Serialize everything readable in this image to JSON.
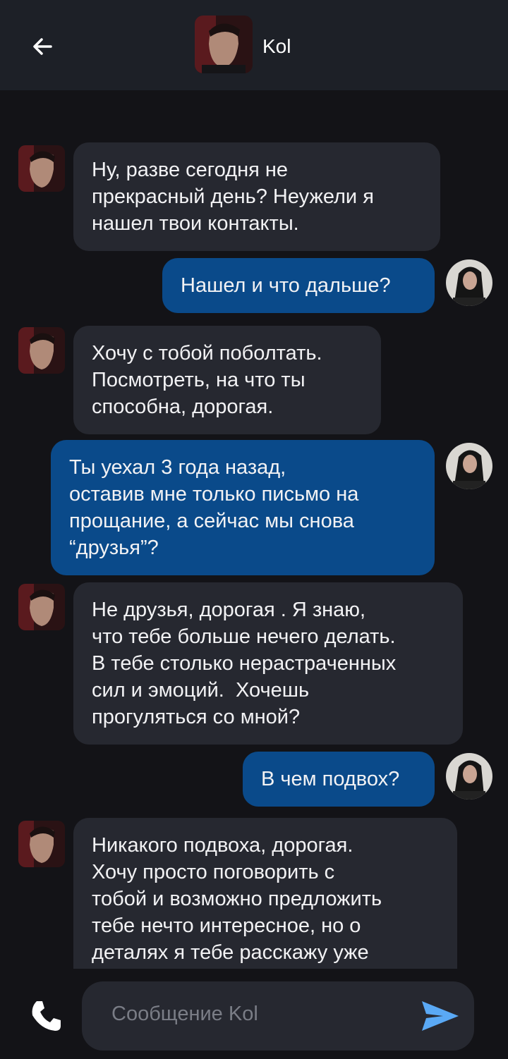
{
  "header": {
    "title": "Kol",
    "back_icon": "arrow-left-icon",
    "avatar": "contact-avatar"
  },
  "messages": [
    {
      "side": "in",
      "text": "Ну, разве сегодня не\nпрекрасный день? Неужели я\nнашел твои контакты."
    },
    {
      "side": "out",
      "text": "Нашел и что дальше?"
    },
    {
      "side": "in",
      "text": "Хочу с тобой поболтать.\nПосмотреть, на что ты\nспособна, дорогая."
    },
    {
      "side": "out",
      "text": "Ты уехал 3 года назад,\nоставив мне только письмо на\nпрощание, а сейчас мы снова\n“друзья”?"
    },
    {
      "side": "in",
      "text": "Не друзья, дорогая . Я знаю,\nчто тебе больше нечего делать.\nВ тебе столько нерастраченных\nсил и эмоций.  Хочешь\nпрогуляться со мной?"
    },
    {
      "side": "out",
      "text": "В чем подвох?"
    },
    {
      "side": "in",
      "text": "Никакого подвоха, дорогая.\nХочу просто поговорить с\nтобой и возможно предложить\nтебе нечто интересное, но о\nдеталях я тебе расскажу уже"
    }
  ],
  "composer": {
    "placeholder": "Сообщение Kol",
    "call_icon": "phone-icon",
    "send_icon": "send-icon"
  },
  "colors": {
    "background": "#131317",
    "header": "#1d2027",
    "incoming_bubble": "#262830",
    "outgoing_bubble": "#0a4a8a",
    "send_accent": "#5aa9f5"
  }
}
